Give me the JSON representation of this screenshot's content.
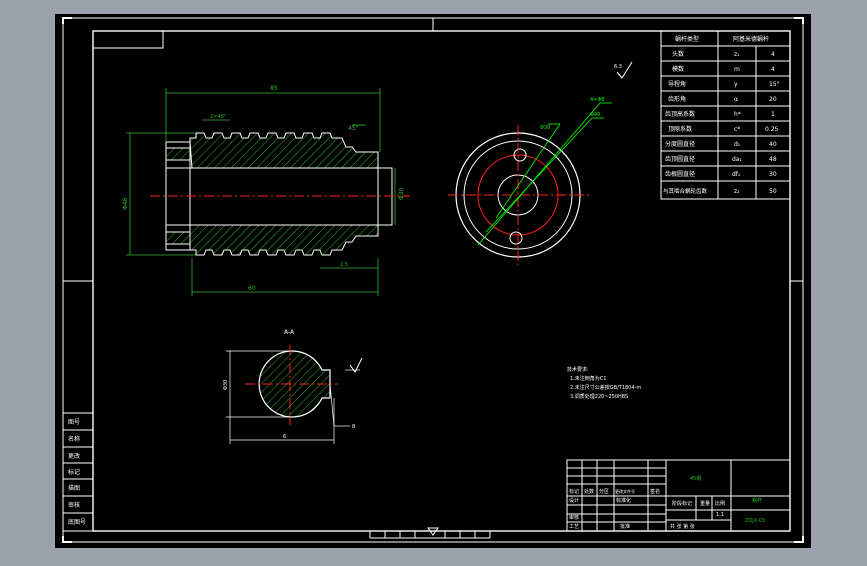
{
  "colors": {
    "window": "#9ba2ab",
    "canvas": "#000000",
    "frame": "#ffffff",
    "outline": "#ffffff",
    "hatch": "#2fb82f",
    "dim": "#2fb82f",
    "center": "#ff2020",
    "hidden": "#ff2020",
    "leader": "#00ff00"
  },
  "param_table": {
    "header": [
      "蜗杆类型",
      "阿基米德蜗杆"
    ],
    "rows": [
      [
        "头数",
        "z₁",
        "4"
      ],
      [
        "模数",
        "m",
        "4"
      ],
      [
        "导程角",
        "γ",
        "15°"
      ],
      [
        "齿形角",
        "α",
        "20"
      ],
      [
        "齿顶高系数",
        "h*",
        "1"
      ],
      [
        "顶隙系数",
        "c*",
        "0.25"
      ],
      [
        "分度圆直径",
        "d₁",
        "40"
      ],
      [
        "齿顶圆直径",
        "da₁",
        "48"
      ],
      [
        "齿根圆直径",
        "df₁",
        "30"
      ],
      [
        "与其啮合蜗轮齿数",
        "z₂",
        "50"
      ]
    ]
  },
  "dims": {
    "total_length": "85",
    "chamfer": "45°",
    "small_top": "2×45°",
    "thread_len": "60",
    "left_dia": "Φ48",
    "right_dia": "Φ30",
    "bottom_len": "2.5",
    "section_a": "A-A",
    "key_depth": "6",
    "key_width": "8",
    "section_dia": "Φ30"
  },
  "end_view_labels": [
    "4×Φ8",
    "Φ40",
    "Φ30"
  ],
  "roughness_mark": "6.3",
  "tech_notes": {
    "title": "技术要求:",
    "lines": [
      "1.未注倒角为C1",
      "2.未注尺寸公差按GB/T1804-m",
      "3.调质处理220~250HBS"
    ]
  },
  "side_labels": [
    "图号",
    "名称",
    "更改",
    "标记",
    "描图",
    "审核",
    "底图号"
  ],
  "title_block": {
    "material": "45钢",
    "part_name": "蜗杆",
    "drawing_no": "ZDJX-03",
    "scale_label": "比例",
    "scale": "1:1",
    "weight_label": "重量",
    "sheet_label": "共 张 第 张",
    "row_labels": [
      "标记",
      "处数",
      "分区",
      "更改文件号",
      "签名",
      "年月日"
    ],
    "designer": "设计",
    "standard": "标准化",
    "checker": "审核",
    "process": "工艺",
    "approve": "批准",
    "stage_label": "阶段标记"
  }
}
